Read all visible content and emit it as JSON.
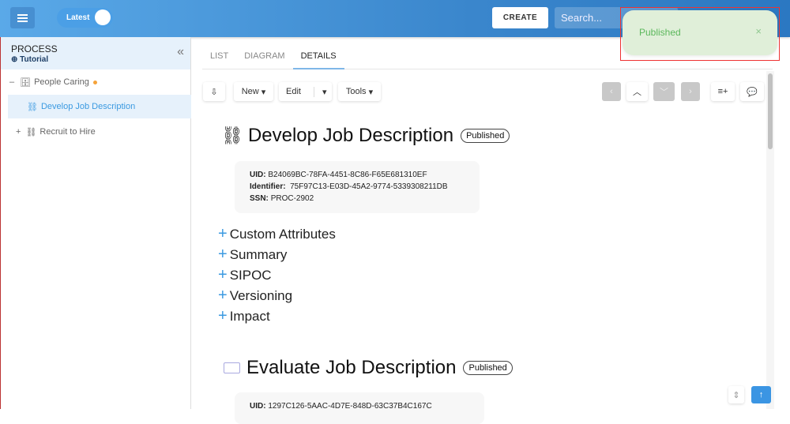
{
  "header": {
    "version_label": "Latest",
    "create_label": "CREATE",
    "search_placeholder": "Search..."
  },
  "toast": {
    "message": "Published",
    "close": "×"
  },
  "sidebar": {
    "title": "PROCESS",
    "subtitle": "Tutorial",
    "collapse": "«",
    "items": [
      {
        "label": "People Caring",
        "toggle": "–"
      },
      {
        "label": "Develop Job Description"
      },
      {
        "label": "Recruit to Hire",
        "toggle": "+"
      }
    ]
  },
  "tabs": [
    "LIST",
    "DIAGRAM",
    "DETAILS"
  ],
  "toolbar": {
    "new": "New",
    "edit": "Edit",
    "tools": "Tools"
  },
  "processes": [
    {
      "title": "Develop Job Description",
      "status": "Published",
      "uid_label": "UID:",
      "uid": "B24069BC-78FA-4451-8C86-F65E681310EF",
      "identifier_label": "Identifier:",
      "identifier": "75F97C13-E03D-45A2-9774-5339308211DB",
      "ssn_label": "SSN:",
      "ssn": "PROC-2902"
    },
    {
      "title": "Evaluate Job Description",
      "status": "Published",
      "uid_label": "UID:",
      "uid": "1297C126-5AAC-4D7E-848D-63C37B4C167C"
    }
  ],
  "sections": [
    "Custom Attributes",
    "Summary",
    "SIPOC",
    "Versioning",
    "Impact"
  ]
}
